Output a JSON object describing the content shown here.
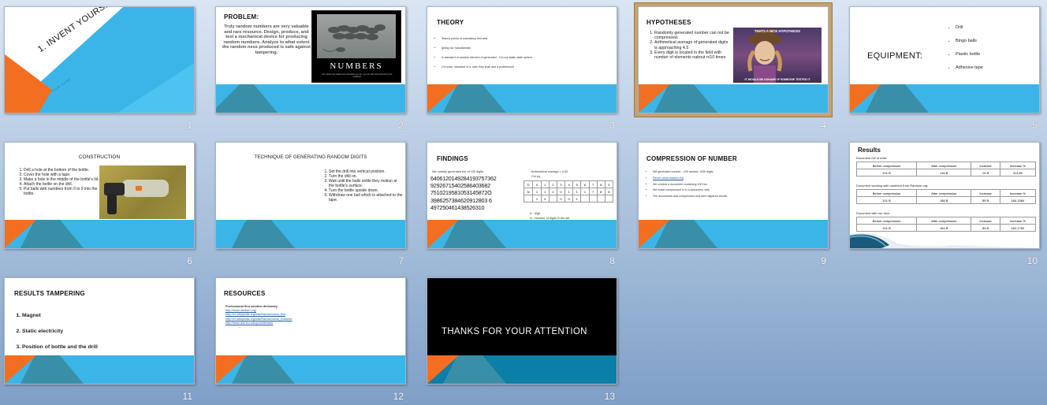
{
  "slides": [
    {
      "num": "1",
      "title": "1. INVENT YOURSELF",
      "sub": "TEAM NAME"
    },
    {
      "num": "2",
      "title": "PROBLEM:",
      "body": "Truly random numbers are very valuable and rare resource. Design, produce, and test a mechanical device for producing random numbers. Analyze to what extent the random ness produced is safe against tampering.",
      "poster": "NUMBERS",
      "poster_caption": "No matter how skilled and educated you are, you are still outnumbered by the mediocre."
    },
    {
      "num": "3",
      "title": "THEORY",
      "items": [
        "Stanny pointa of mandatory test sets",
        "giving our mandateasts",
        "is standard of random element of generated - it in our static state sphere.",
        "Chi sone, standard of a, stan they shall and a problemunit"
      ]
    },
    {
      "num": "4",
      "title": "HYPOTHESES",
      "items": [
        "Randomly generated number can not be compressed.",
        "Arithmetical average of generated digits is approaching 4.5",
        "Every digit is located in the field with number of elements nabout n/10 times"
      ],
      "meme_top": "THATS A NICE HYPOTHESIS",
      "meme_bottom": "IT WOULD BE ASHAME IF SOMEONE TESTED IT"
    },
    {
      "num": "5",
      "title": "EQUIPMENT:",
      "items": [
        "Drill",
        "Bingo balls",
        "Plastic bottle",
        "Adhesive tape"
      ]
    },
    {
      "num": "6",
      "title": "CONSTRUCTION",
      "items": [
        "Drill a hole at the bottom of the bottle.",
        "Cover the hole with a tape.",
        "Make a hole in the middle of the bottle's lid.",
        "Attach the bottle on the drill.",
        "Put balls with numbers from 0 to 9 into the bottle."
      ]
    },
    {
      "num": "7",
      "title": "TECHNIQUE OF GENERATING RANDOM DIGITS",
      "items": [
        "Set the drill into vertical position.",
        "Turn the drill on.",
        "Wait until the balls settle they motion at the bottle's surface.",
        "Turn the bottle upside down.",
        "Withdraw one ball which is attached to the tape."
      ]
    },
    {
      "num": "8",
      "title": "FINDINGS",
      "intro": "We notedly generated the of 100 digits.",
      "digits": [
        "6406120149284193757362",
        "92926715402586403682",
        "7510219581053145872O",
        "3986257384620912803 6",
        "497250461438526310"
      ],
      "stats_a": "Arithmetical average = 4,30",
      "stats_b": "Chi sq.",
      "header": [
        "D",
        "0",
        "1",
        "2",
        "3",
        "4",
        "5",
        "6",
        "7",
        "8",
        "9"
      ],
      "row": [
        "N",
        "1",
        "1",
        "1",
        "0",
        "1",
        "1",
        "1",
        "7",
        "8",
        "8"
      ],
      "row2": [
        "",
        "1",
        "4",
        "",
        "0",
        "0",
        "1",
        "",
        "",
        "",
        ""
      ],
      "legend_a": "D - digit",
      "legend_b": "N - Number of digits in the set"
    },
    {
      "num": "9",
      "title": "COMPRESSION  OF NUMBER",
      "items": [
        "We generated number - 100 random 1000 digits.",
        "Rerurl: www.random.org",
        "We created a document containing 100 hut.",
        "We made compressed in to a document, with",
        "The documents was compressed and were digitized results."
      ]
    },
    {
      "num": "10",
      "title": "Results",
      "groups": [
        {
          "caption": "Document full of nulls:",
          "head": [
            "Before compression",
            "After compression",
            "Increase",
            "Increase %"
          ],
          "row": [
            "101 B",
            "116 B",
            "15 B",
            "114,85"
          ]
        },
        {
          "caption": "Document working with numbers from Random.org:",
          "head": [
            "Before compression",
            "After compression",
            "Increase",
            "Increase %"
          ],
          "row": [
            "101 B",
            "186 B",
            "85 B",
            "184,1584"
          ]
        },
        {
          "caption": "Document with our dice:",
          "head": [
            "Before compression",
            "After compression",
            "Increase",
            "Increase %"
          ],
          "row": [
            "101 B",
            "184 B",
            "83 B",
            "182,1782"
          ]
        }
      ]
    },
    {
      "num": "11",
      "title": "RESULTS TAMPERING",
      "items": [
        "Magnet",
        "Static electricity",
        "Position of bottle and the drill"
      ]
    },
    {
      "num": "12",
      "title": "RESOURCES",
      "items": [
        "Professional first solution dictionary",
        "http://www.random.org/",
        "http://en.wikipedia.org/wiki/Randomness_test",
        "http://en.wikipedia.org/wiki/Randomness_extractor",
        "http://www.stat.fsu.edu/pub/diehard/",
        "..."
      ]
    },
    {
      "num": "13",
      "title": "THANKS FOR YOUR ATTENTION"
    }
  ],
  "colors": {
    "orange": "#f26f21",
    "blue": "#3bb5e8",
    "teal": "#3a8fa8",
    "dark": "#0b7fa8"
  }
}
